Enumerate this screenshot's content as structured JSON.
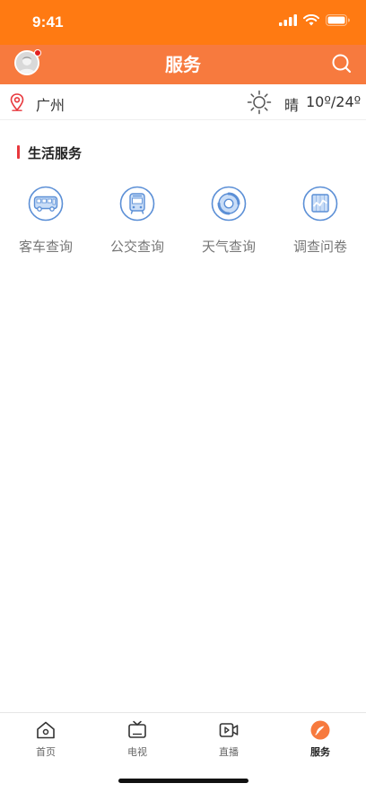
{
  "status_bar": {
    "time": "9:41"
  },
  "header": {
    "title": "服务"
  },
  "location": {
    "city": "广州"
  },
  "weather": {
    "condition": "晴",
    "temperature": "10º/24º"
  },
  "section": {
    "title": "生活服务"
  },
  "services": [
    {
      "label": "客车查询",
      "icon": "coach-bus-icon"
    },
    {
      "label": "公交查询",
      "icon": "city-bus-icon"
    },
    {
      "label": "天气查询",
      "icon": "weather-swirl-icon"
    },
    {
      "label": "调查问卷",
      "icon": "survey-chart-icon"
    }
  ],
  "tabbar": {
    "items": [
      {
        "label": "首页",
        "icon": "home-icon"
      },
      {
        "label": "电视",
        "icon": "tv-icon"
      },
      {
        "label": "直播",
        "icon": "live-video-icon"
      },
      {
        "label": "服务",
        "icon": "service-compass-icon",
        "active": true
      }
    ]
  },
  "colors": {
    "status_bar": "#ff7a12",
    "header": "#f77a3e",
    "accent_red": "#e8383d",
    "icon_blue": "#5b8fd6",
    "active_tab": "#f77a3e"
  }
}
